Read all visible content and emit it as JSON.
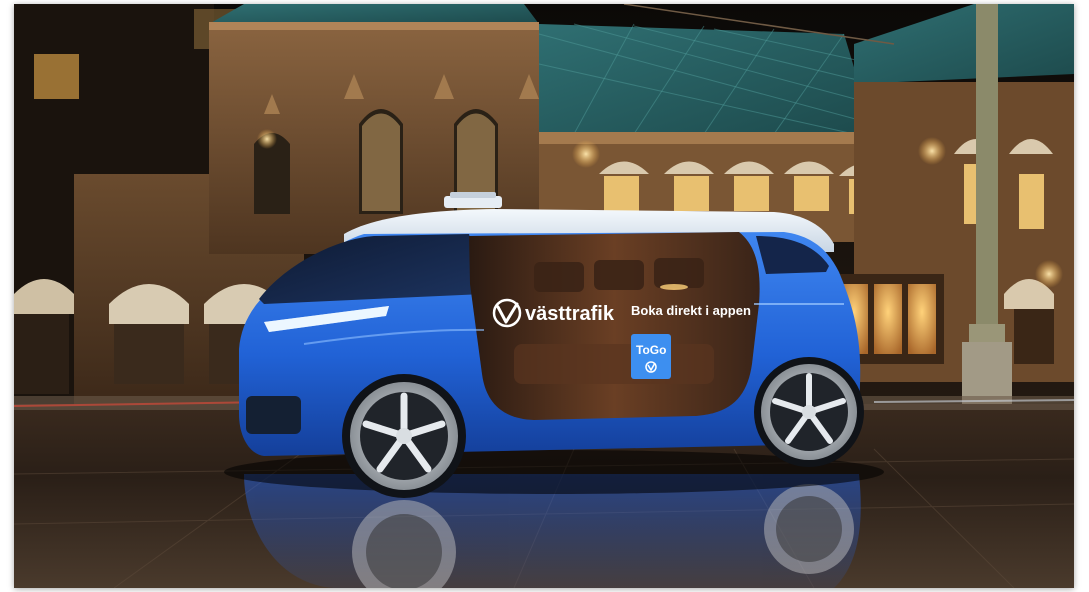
{
  "photo": {
    "brand_name": "västtrafik",
    "door_text": "Boka direkt i appen",
    "door_badge": "ToGo"
  }
}
